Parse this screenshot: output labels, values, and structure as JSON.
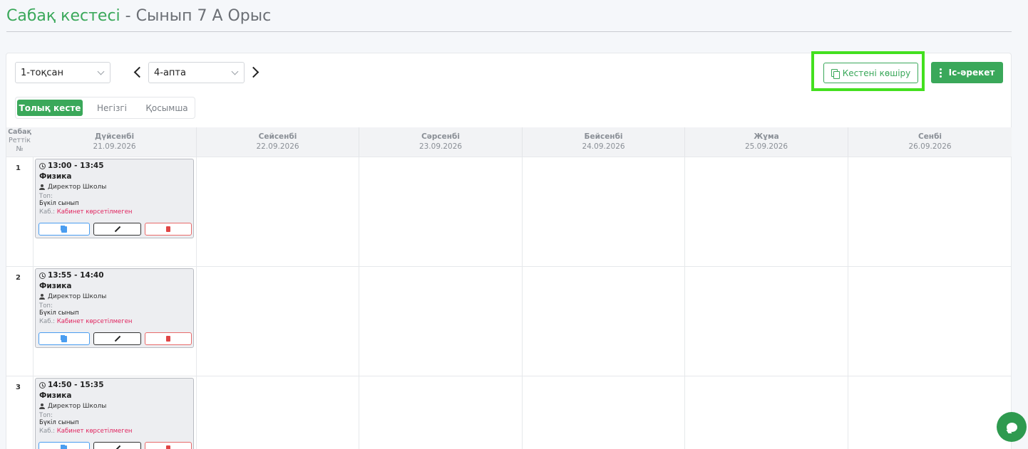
{
  "page": {
    "title_main": "Сабақ кестесі",
    "title_sep": " - ",
    "title_class": "Сынып 7 А Орыс"
  },
  "filters": {
    "quarter": "1-тоқсан",
    "week": "4-апта"
  },
  "toolbar": {
    "copy_label": "Кестені көшіру",
    "action_label": "Іс-әрекет"
  },
  "tabs": [
    {
      "label": "Толық кесте",
      "active": true
    },
    {
      "label": "Негізгі",
      "active": false
    },
    {
      "label": "Қосымша",
      "active": false
    }
  ],
  "grid": {
    "row_header": [
      "Сабақ",
      "Реттік",
      "№"
    ],
    "days": [
      {
        "name": "Дүйсенбі",
        "date": "21.09.2026"
      },
      {
        "name": "Сейсенбі",
        "date": "22.09.2026"
      },
      {
        "name": "Сәрсенбі",
        "date": "23.09.2026"
      },
      {
        "name": "Бейсенбі",
        "date": "24.09.2026"
      },
      {
        "name": "Жұма",
        "date": "25.09.2026"
      },
      {
        "name": "Сенбі",
        "date": "26.09.2026"
      }
    ],
    "rows": [
      {
        "num": "1",
        "lesson": {
          "time": "13:00 - 13:45",
          "subject": "Физика",
          "teacher": "Директор Школы",
          "group_label": "Топ:",
          "group": "Бүкіл сынып",
          "cab_label": "Каб.:",
          "cab": "Кабинет көрсетілмеген"
        }
      },
      {
        "num": "2",
        "lesson": {
          "time": "13:55 - 14:40",
          "subject": "Физика",
          "teacher": "Директор Школы",
          "group_label": "Топ:",
          "group": "Бүкіл сынып",
          "cab_label": "Каб.:",
          "cab": "Кабинет көрсетілмеген"
        }
      },
      {
        "num": "3",
        "lesson": {
          "time": "14:50 - 15:35",
          "subject": "Физика",
          "teacher": "Директор Школы",
          "group_label": "Топ:",
          "group": "Бүкіл сынып",
          "cab_label": "Каб.:",
          "cab": "Кабинет көрсетілмеген"
        }
      }
    ]
  },
  "colors": {
    "brand_green": "#3aa85a",
    "highlight": "#44e01f",
    "cab_red": "#e0245e"
  }
}
